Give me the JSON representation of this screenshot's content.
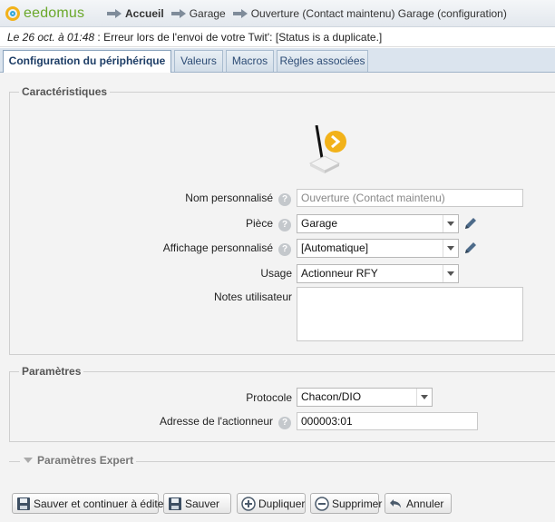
{
  "app": {
    "logo_text": "eedomus"
  },
  "breadcrumb": [
    {
      "label": "Accueil"
    },
    {
      "label": "Garage"
    },
    {
      "label": "Ouverture (Contact maintenu) Garage (configuration)"
    }
  ],
  "message": {
    "date": "Le 26 oct. à 01:48",
    "text": " : Erreur lors de l'envoi de votre Twit': [Status is a duplicate.]"
  },
  "tabs": [
    {
      "label": "Configuration du périphérique",
      "active": true
    },
    {
      "label": "Valeurs",
      "active": false
    },
    {
      "label": "Macros",
      "active": false
    },
    {
      "label": "Règles associées",
      "active": false
    }
  ],
  "characteristics": {
    "legend": "Caractéristiques",
    "custom_name": {
      "label": "Nom personnalisé",
      "value": "Ouverture (Contact maintenu)"
    },
    "room": {
      "label": "Pièce",
      "value": "Garage"
    },
    "display": {
      "label": "Affichage personnalisé",
      "value": "[Automatique]"
    },
    "usage": {
      "label": "Usage",
      "value": "Actionneur RFY"
    },
    "notes": {
      "label": "Notes utilisateur",
      "value": ""
    }
  },
  "parameters": {
    "legend": "Paramètres",
    "protocol": {
      "label": "Protocole",
      "value": "Chacon/DIO"
    },
    "address": {
      "label": "Adresse de l'actionneur",
      "value": "000003:01"
    }
  },
  "expert": {
    "label": "Paramètres Expert"
  },
  "buttons": {
    "save_continue": "Sauver et continuer à éditer",
    "save": "Sauver",
    "duplicate": "Dupliquer",
    "delete": "Supprimer",
    "cancel": "Annuler"
  },
  "help_glyph": "?",
  "colors": {
    "accent": "#2c4b74",
    "logo_green": "#6aa82a",
    "logo_yellow": "#f2b21a",
    "logo_blue": "#2fa6d9",
    "device_badge": "#f2b21a"
  }
}
